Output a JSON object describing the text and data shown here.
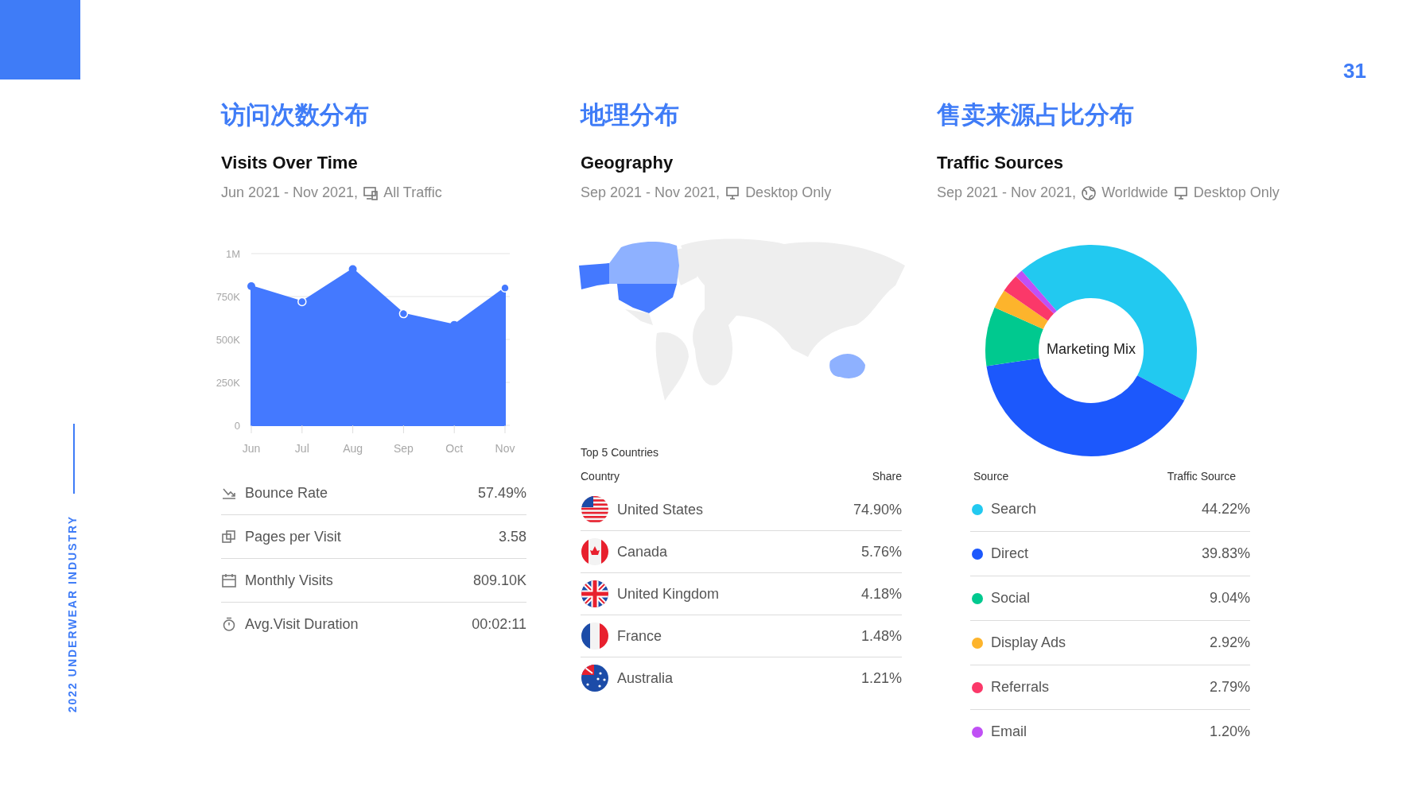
{
  "page_number": "31",
  "side_label": "2022 UNDERWEAR INDUSTRY",
  "visits": {
    "heading": "访问次数分布",
    "title": "Visits Over Time",
    "date": "Jun 2021 - Nov 2021,",
    "filter": "All Traffic",
    "chart_data": {
      "type": "area",
      "categories": [
        "Jun",
        "Jul",
        "Aug",
        "Sep",
        "Oct",
        "Nov"
      ],
      "grid": true,
      "series": [
        {
          "color": "#4479ff",
          "values": [
            810000,
            720000,
            910000,
            650000,
            585000,
            800000
          ]
        }
      ],
      "ylim": [
        0,
        1000000
      ],
      "yticks": [
        {
          "value": 0,
          "label": "0"
        },
        {
          "value": 250000,
          "label": "250K"
        },
        {
          "value": 500000,
          "label": "500K"
        },
        {
          "value": 750000,
          "label": "750K"
        },
        {
          "value": 1000000,
          "label": "1M"
        }
      ]
    },
    "stats": [
      {
        "kind": "bounce",
        "label": "Bounce Rate",
        "value": "57.49%"
      },
      {
        "kind": "pages",
        "label": "Pages per Visit",
        "value": "3.58"
      },
      {
        "kind": "calendar",
        "label": "Monthly Visits",
        "value": "809.10K"
      },
      {
        "kind": "timer",
        "label": "Avg.Visit Duration",
        "value": "00:02:11"
      }
    ]
  },
  "geography": {
    "heading": "地理分布",
    "title": "Geography",
    "date": "Sep 2021 - Nov 2021,",
    "filter": "Desktop Only",
    "table_title": "Top 5 Countries",
    "columns": [
      "Country",
      "Share"
    ],
    "countries": [
      {
        "kind": "us",
        "name": "United States",
        "share": "74.90%"
      },
      {
        "kind": "ca",
        "name": "Canada",
        "share": "5.76%"
      },
      {
        "kind": "gb",
        "name": "United Kingdom",
        "share": "4.18%"
      },
      {
        "kind": "fr",
        "name": "France",
        "share": "1.48%"
      },
      {
        "kind": "au",
        "name": "Australia",
        "share": "1.21%"
      }
    ]
  },
  "traffic": {
    "heading": "售卖来源占比分布",
    "title": "Traffic Sources",
    "date": "Sep 2021 - Nov 2021,",
    "region": "Worldwide",
    "filter": "Desktop Only",
    "center_label": "Marketing Mix",
    "columns": [
      "Source",
      "Traffic Source"
    ],
    "chart_data": {
      "type": "donut",
      "values": [
        44.22,
        39.83,
        9.04,
        2.92,
        2.79,
        1.2
      ]
    },
    "sources": [
      {
        "name": "Search",
        "share": "44.22%",
        "color": "#22c9f0"
      },
      {
        "name": "Direct",
        "share": "39.83%",
        "color": "#1c58fc"
      },
      {
        "name": "Social",
        "share": "9.04%",
        "color": "#00c98f"
      },
      {
        "name": "Display Ads",
        "share": "2.92%",
        "color": "#fdb42c"
      },
      {
        "name": "Referrals",
        "share": "2.79%",
        "color": "#fb3869"
      },
      {
        "name": "Email",
        "share": "1.20%",
        "color": "#c050f5"
      }
    ]
  }
}
